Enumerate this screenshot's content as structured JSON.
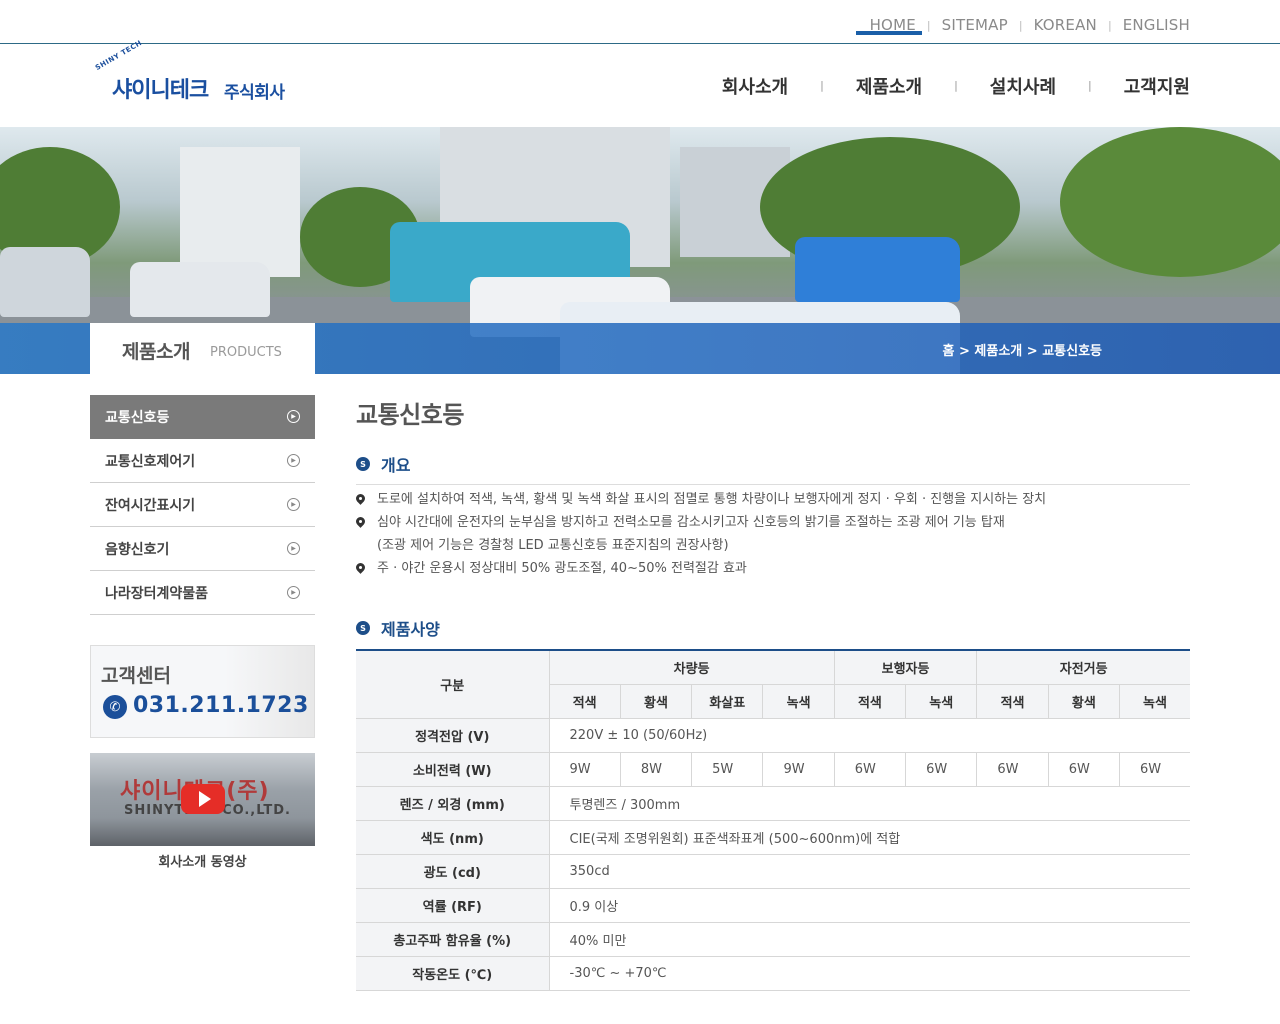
{
  "util_links": [
    "HOME",
    "SITEMAP",
    "KOREAN",
    "ENGLISH"
  ],
  "logo": {
    "arc": "SHINY TECH",
    "main": "샤이니테크",
    "sub": "주식회사"
  },
  "gnb": [
    "회사소개",
    "제품소개",
    "설치사례",
    "고객지원"
  ],
  "gnb_active_index": 1,
  "banner": {
    "section_title": "제품소개",
    "section_title_en": "PRODUCTS",
    "breadcrumb": "홈 > 제품소개 > 교통신호등"
  },
  "lnb": {
    "items": [
      "교통신호등",
      "교통신호제어기",
      "잔여시간표시기",
      "음향신호기",
      "나라장터계약물품"
    ],
    "active_index": 0
  },
  "customer_center": {
    "title": "고객센터",
    "phone": "031.211.1723"
  },
  "video": {
    "sign_text": "샤이니테크(주)",
    "sign_en": "SHINYTECH CO.,LTD.",
    "caption": "회사소개 동영상"
  },
  "content": {
    "title": "교통신호등",
    "overview_title": "개요",
    "overview": [
      "도로에 설치하여 적색, 녹색, 황색 및 녹색 화살 표시의 점멸로 통행 차량이나 보행자에게 정지 · 우회 · 진행을 지시하는 장치",
      "심야 시간대에 운전자의 눈부심을 방지하고 전력소모를 감소시키고자 신호등의 밝기를 조절하는 조광 제어 기능 탑재",
      "주 · 야간 운용시 정상대비 50% 광도조절, 40~50% 전력절감 효과"
    ],
    "overview_note": "(조광 제어 기능은 경찰청 LED 교통신호등 표준지침의 권장사항)",
    "spec_title": "제품사양",
    "spec": {
      "corner": "구분",
      "groups": [
        "차량등",
        "보행자등",
        "자전거등"
      ],
      "columns": [
        "적색",
        "황색",
        "화살표",
        "녹색",
        "적색",
        "녹색",
        "적색",
        "황색",
        "녹색"
      ],
      "rows": [
        {
          "label": "정격전압 (V)",
          "value": "220V ± 10 (50/60Hz)"
        },
        {
          "label": "소비전력 (W)",
          "values": [
            "9W",
            "8W",
            "5W",
            "9W",
            "6W",
            "6W",
            "6W",
            "6W",
            "6W"
          ]
        },
        {
          "label": "렌즈 / 외경 (mm)",
          "value": "투명렌즈 / 300mm"
        },
        {
          "label": "색도 (nm)",
          "value": "CIE(국제 조명위원회) 표준색좌표계 (500~600nm)에 적합"
        },
        {
          "label": "광도 (cd)",
          "value": "350cd"
        },
        {
          "label": "역률 (RF)",
          "value": "0.9 이상"
        },
        {
          "label": "총고주파 함유율 (%)",
          "value": "40% 미만"
        },
        {
          "label": "작동온도 (℃)",
          "value": "-30℃ ~ +70℃"
        }
      ]
    }
  },
  "colors": {
    "accent": "#1d4e89",
    "brand": "#1a4fa0",
    "lnb_active": "#7a7a7a",
    "youtube": "#e52d27"
  }
}
